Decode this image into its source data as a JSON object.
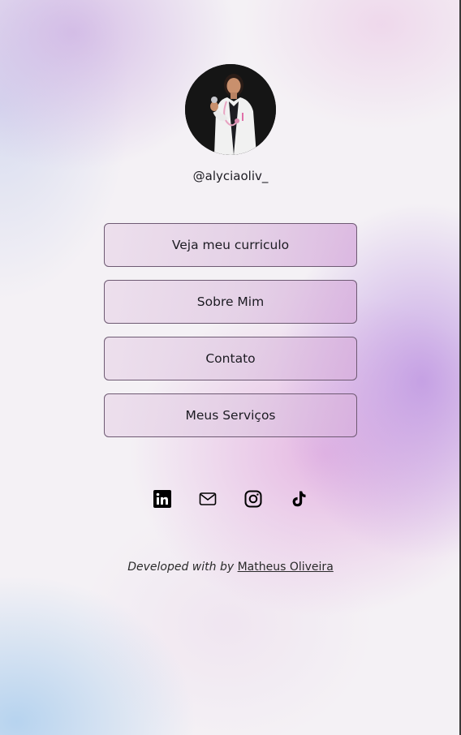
{
  "profile": {
    "handle": "@alyciaoliv_",
    "avatar_alt": "profile-photo"
  },
  "links": [
    {
      "label": "Veja meu curriculo"
    },
    {
      "label": "Sobre Mim"
    },
    {
      "label": "Contato"
    },
    {
      "label": "Meus Serviços"
    }
  ],
  "socials": [
    {
      "icon": "linkedin-icon"
    },
    {
      "icon": "mail-icon"
    },
    {
      "icon": "instagram-icon"
    },
    {
      "icon": "tiktok-icon"
    }
  ],
  "footer": {
    "prefix": "Developed with by",
    "author": "Matheus Oliveira"
  }
}
